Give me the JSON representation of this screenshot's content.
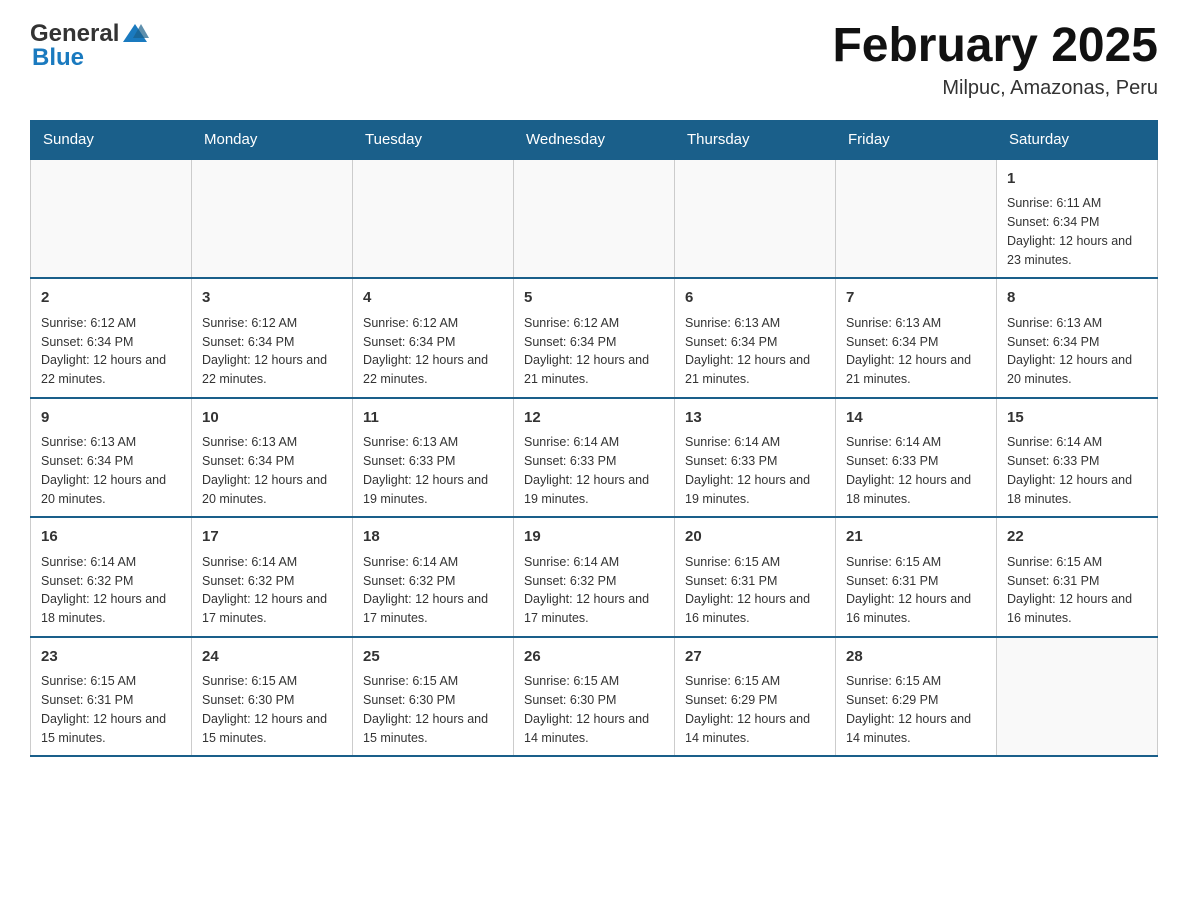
{
  "header": {
    "logo_general": "General",
    "logo_blue": "Blue",
    "month_title": "February 2025",
    "location": "Milpuc, Amazonas, Peru"
  },
  "weekdays": [
    "Sunday",
    "Monday",
    "Tuesday",
    "Wednesday",
    "Thursday",
    "Friday",
    "Saturday"
  ],
  "weeks": [
    [
      {
        "day": "",
        "sunrise": "",
        "sunset": "",
        "daylight": ""
      },
      {
        "day": "",
        "sunrise": "",
        "sunset": "",
        "daylight": ""
      },
      {
        "day": "",
        "sunrise": "",
        "sunset": "",
        "daylight": ""
      },
      {
        "day": "",
        "sunrise": "",
        "sunset": "",
        "daylight": ""
      },
      {
        "day": "",
        "sunrise": "",
        "sunset": "",
        "daylight": ""
      },
      {
        "day": "",
        "sunrise": "",
        "sunset": "",
        "daylight": ""
      },
      {
        "day": "1",
        "sunrise": "Sunrise: 6:11 AM",
        "sunset": "Sunset: 6:34 PM",
        "daylight": "Daylight: 12 hours and 23 minutes."
      }
    ],
    [
      {
        "day": "2",
        "sunrise": "Sunrise: 6:12 AM",
        "sunset": "Sunset: 6:34 PM",
        "daylight": "Daylight: 12 hours and 22 minutes."
      },
      {
        "day": "3",
        "sunrise": "Sunrise: 6:12 AM",
        "sunset": "Sunset: 6:34 PM",
        "daylight": "Daylight: 12 hours and 22 minutes."
      },
      {
        "day": "4",
        "sunrise": "Sunrise: 6:12 AM",
        "sunset": "Sunset: 6:34 PM",
        "daylight": "Daylight: 12 hours and 22 minutes."
      },
      {
        "day": "5",
        "sunrise": "Sunrise: 6:12 AM",
        "sunset": "Sunset: 6:34 PM",
        "daylight": "Daylight: 12 hours and 21 minutes."
      },
      {
        "day": "6",
        "sunrise": "Sunrise: 6:13 AM",
        "sunset": "Sunset: 6:34 PM",
        "daylight": "Daylight: 12 hours and 21 minutes."
      },
      {
        "day": "7",
        "sunrise": "Sunrise: 6:13 AM",
        "sunset": "Sunset: 6:34 PM",
        "daylight": "Daylight: 12 hours and 21 minutes."
      },
      {
        "day": "8",
        "sunrise": "Sunrise: 6:13 AM",
        "sunset": "Sunset: 6:34 PM",
        "daylight": "Daylight: 12 hours and 20 minutes."
      }
    ],
    [
      {
        "day": "9",
        "sunrise": "Sunrise: 6:13 AM",
        "sunset": "Sunset: 6:34 PM",
        "daylight": "Daylight: 12 hours and 20 minutes."
      },
      {
        "day": "10",
        "sunrise": "Sunrise: 6:13 AM",
        "sunset": "Sunset: 6:34 PM",
        "daylight": "Daylight: 12 hours and 20 minutes."
      },
      {
        "day": "11",
        "sunrise": "Sunrise: 6:13 AM",
        "sunset": "Sunset: 6:33 PM",
        "daylight": "Daylight: 12 hours and 19 minutes."
      },
      {
        "day": "12",
        "sunrise": "Sunrise: 6:14 AM",
        "sunset": "Sunset: 6:33 PM",
        "daylight": "Daylight: 12 hours and 19 minutes."
      },
      {
        "day": "13",
        "sunrise": "Sunrise: 6:14 AM",
        "sunset": "Sunset: 6:33 PM",
        "daylight": "Daylight: 12 hours and 19 minutes."
      },
      {
        "day": "14",
        "sunrise": "Sunrise: 6:14 AM",
        "sunset": "Sunset: 6:33 PM",
        "daylight": "Daylight: 12 hours and 18 minutes."
      },
      {
        "day": "15",
        "sunrise": "Sunrise: 6:14 AM",
        "sunset": "Sunset: 6:33 PM",
        "daylight": "Daylight: 12 hours and 18 minutes."
      }
    ],
    [
      {
        "day": "16",
        "sunrise": "Sunrise: 6:14 AM",
        "sunset": "Sunset: 6:32 PM",
        "daylight": "Daylight: 12 hours and 18 minutes."
      },
      {
        "day": "17",
        "sunrise": "Sunrise: 6:14 AM",
        "sunset": "Sunset: 6:32 PM",
        "daylight": "Daylight: 12 hours and 17 minutes."
      },
      {
        "day": "18",
        "sunrise": "Sunrise: 6:14 AM",
        "sunset": "Sunset: 6:32 PM",
        "daylight": "Daylight: 12 hours and 17 minutes."
      },
      {
        "day": "19",
        "sunrise": "Sunrise: 6:14 AM",
        "sunset": "Sunset: 6:32 PM",
        "daylight": "Daylight: 12 hours and 17 minutes."
      },
      {
        "day": "20",
        "sunrise": "Sunrise: 6:15 AM",
        "sunset": "Sunset: 6:31 PM",
        "daylight": "Daylight: 12 hours and 16 minutes."
      },
      {
        "day": "21",
        "sunrise": "Sunrise: 6:15 AM",
        "sunset": "Sunset: 6:31 PM",
        "daylight": "Daylight: 12 hours and 16 minutes."
      },
      {
        "day": "22",
        "sunrise": "Sunrise: 6:15 AM",
        "sunset": "Sunset: 6:31 PM",
        "daylight": "Daylight: 12 hours and 16 minutes."
      }
    ],
    [
      {
        "day": "23",
        "sunrise": "Sunrise: 6:15 AM",
        "sunset": "Sunset: 6:31 PM",
        "daylight": "Daylight: 12 hours and 15 minutes."
      },
      {
        "day": "24",
        "sunrise": "Sunrise: 6:15 AM",
        "sunset": "Sunset: 6:30 PM",
        "daylight": "Daylight: 12 hours and 15 minutes."
      },
      {
        "day": "25",
        "sunrise": "Sunrise: 6:15 AM",
        "sunset": "Sunset: 6:30 PM",
        "daylight": "Daylight: 12 hours and 15 minutes."
      },
      {
        "day": "26",
        "sunrise": "Sunrise: 6:15 AM",
        "sunset": "Sunset: 6:30 PM",
        "daylight": "Daylight: 12 hours and 14 minutes."
      },
      {
        "day": "27",
        "sunrise": "Sunrise: 6:15 AM",
        "sunset": "Sunset: 6:29 PM",
        "daylight": "Daylight: 12 hours and 14 minutes."
      },
      {
        "day": "28",
        "sunrise": "Sunrise: 6:15 AM",
        "sunset": "Sunset: 6:29 PM",
        "daylight": "Daylight: 12 hours and 14 minutes."
      },
      {
        "day": "",
        "sunrise": "",
        "sunset": "",
        "daylight": ""
      }
    ]
  ]
}
